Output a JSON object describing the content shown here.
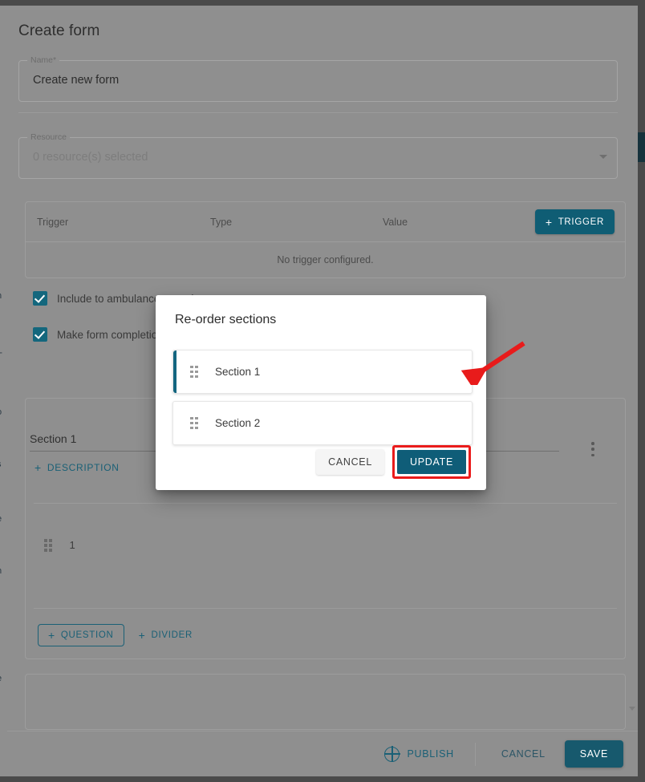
{
  "page": {
    "title": "Create form"
  },
  "fields": {
    "name": {
      "legend": "Name*",
      "value": "Create new form"
    },
    "resource": {
      "legend": "Resource",
      "value": "0 resource(s) selected",
      "caret_icon": "chevron-down-icon"
    }
  },
  "trigger_table": {
    "columns": [
      "Trigger",
      "Type",
      "Value"
    ],
    "add_button": {
      "label": "TRIGGER",
      "icon": "plus-icon"
    },
    "empty_message": "No trigger configured.",
    "rows": []
  },
  "checkboxes": [
    {
      "label": "Include to ambulance record note",
      "checked": true
    },
    {
      "label": "Make form completion",
      "checked": true
    }
  ],
  "section_card": {
    "name": "Section 1",
    "description_button": {
      "label": "DESCRIPTION",
      "icon": "plus-icon"
    },
    "kebab_icon": "more-vertical-icon",
    "questions": [
      {
        "number": "1",
        "handle_icon": "drag-handle-icon"
      }
    ],
    "actions": [
      {
        "label": "QUESTION",
        "icon": "plus-icon",
        "style": "outline"
      },
      {
        "label": "DIVIDER",
        "icon": "plus-icon",
        "style": "flat"
      }
    ]
  },
  "footer": {
    "publish": {
      "label": "PUBLISH",
      "icon": "globe-icon"
    },
    "cancel": "CANCEL",
    "save": "SAVE"
  },
  "modal": {
    "title": "Re-order sections",
    "items": [
      {
        "label": "Section 1",
        "handle_icon": "drag-handle-icon",
        "active": true
      },
      {
        "label": "Section 2",
        "handle_icon": "drag-handle-icon",
        "active": false
      }
    ],
    "cancel": "CANCEL",
    "update": "UPDATE"
  },
  "annotation": {
    "arrow_color": "#e81b1b",
    "highlight_color": "#ea1b1b",
    "highlight_target": "UPDATE"
  },
  "colors": {
    "accent": "#0f5d74",
    "accent_dark": "#17596d",
    "link": "#1a6076",
    "checkbox": "#14677d",
    "active_bar": "#13657f",
    "scrim": "#8f8f8f",
    "page_backdrop": "#4a4a4a"
  },
  "left_edge_glyphs": [
    "n",
    "T",
    "o",
    "s",
    "e",
    "n",
    "e"
  ]
}
